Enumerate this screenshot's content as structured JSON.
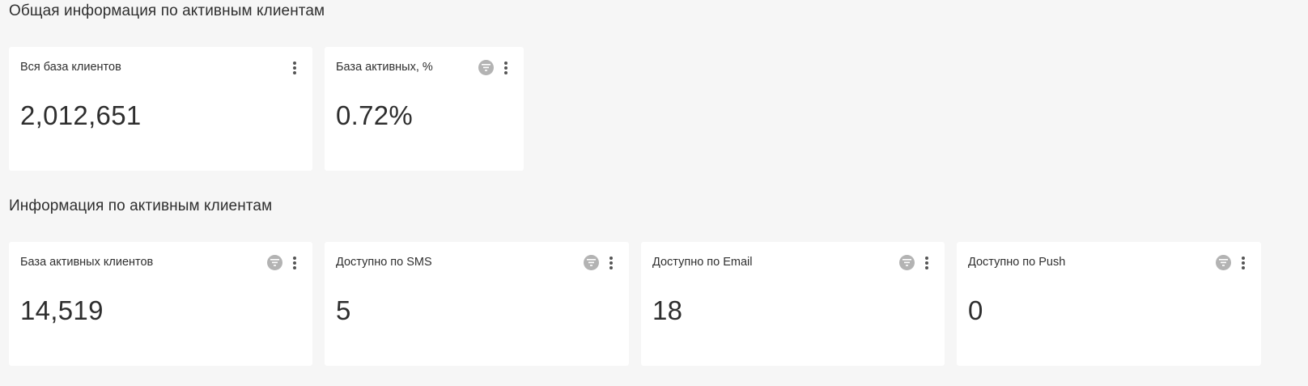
{
  "sections": [
    {
      "title": "Общая информация по активным клиентам",
      "cards": [
        {
          "title": "Вся база клиентов",
          "value": "2,012,651",
          "has_filter": false
        },
        {
          "title": "База активных, %",
          "value": "0.72%",
          "has_filter": true
        }
      ]
    },
    {
      "title": "Информация по активным клиентам",
      "cards": [
        {
          "title": "База активных клиентов",
          "value": "14,519",
          "has_filter": true
        },
        {
          "title": "Доступно по SMS",
          "value": "5",
          "has_filter": true
        },
        {
          "title": "Доступно по Email",
          "value": "18",
          "has_filter": true
        },
        {
          "title": "Доступно по Push",
          "value": "0",
          "has_filter": true
        }
      ]
    }
  ],
  "icons": {
    "filter": "filter-icon",
    "menu": "kebab-menu-icon"
  },
  "colors": {
    "background": "#f6f6f6",
    "card": "#ffffff",
    "filter_badge": "#b3b3b3",
    "text": "#2e2e2e"
  }
}
